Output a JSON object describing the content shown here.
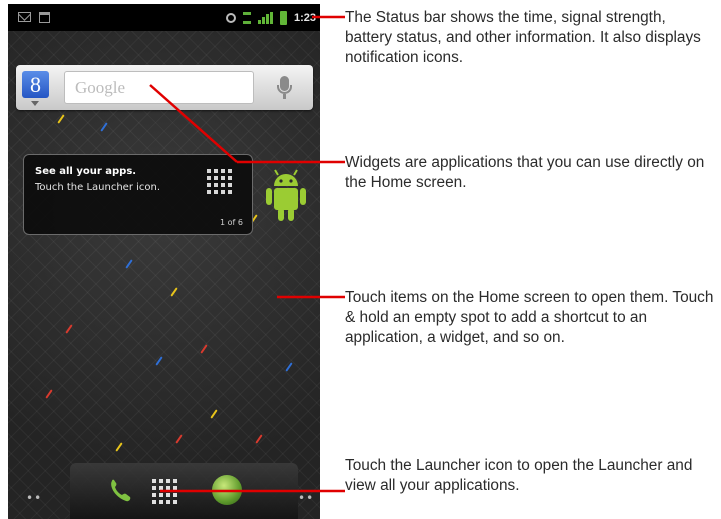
{
  "status_bar": {
    "time": "1:23",
    "icons": [
      "email-notification-icon",
      "calendar-notification-icon",
      "gps-icon",
      "data-activity-icon",
      "signal-strength-icon",
      "battery-icon"
    ]
  },
  "search_widget": {
    "logo_letter": "8",
    "placeholder": "Google",
    "mic_icon": "microphone-icon"
  },
  "launcher_tip": {
    "title": "See all your apps.",
    "body": "Touch the Launcher icon.",
    "pager": "1 of 6"
  },
  "dock": {
    "left_dots": "••",
    "right_dots": "••",
    "icons": [
      "phone-icon",
      "launcher-icon",
      "browser-icon"
    ]
  },
  "callouts": {
    "status_bar": "The Status bar shows the time, signal strength, battery status, and other information. It also displays notification icons.",
    "widgets": "Widgets are applications that you can use directly on the Home screen.",
    "home_screen": "Touch items on the Home screen to open them. Touch & hold an empty spot to add a shortcut to an application, a widget, and so on.",
    "launcher": "Touch the Launcher icon to open the Launcher and view all your applications."
  },
  "colors": {
    "leader_line": "#e00000",
    "status_green": "#61b637",
    "wallpaper": "#2b2b2b"
  }
}
